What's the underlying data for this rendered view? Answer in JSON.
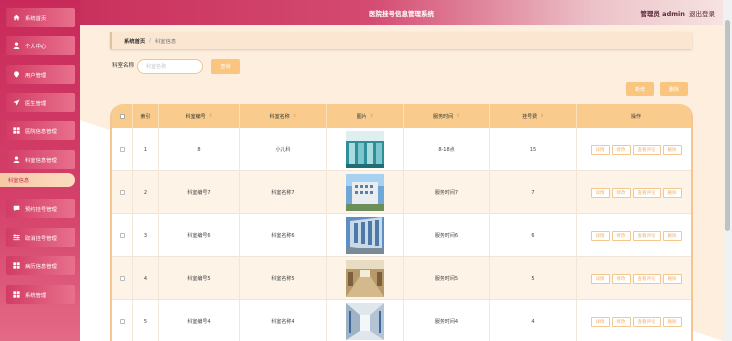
{
  "app": {
    "title": "医院挂号信息管理系统",
    "user_label": "管理员 admin",
    "logout": "退出登录"
  },
  "sidebar": {
    "items": [
      {
        "label": "系统首页",
        "icon": "home-icon"
      },
      {
        "label": "个人中心",
        "icon": "user-icon"
      },
      {
        "label": "用户管理",
        "icon": "pin-icon"
      },
      {
        "label": "医生管理",
        "icon": "send-icon"
      },
      {
        "label": "医院信息管理",
        "icon": "grid-icon"
      },
      {
        "label": "科室信息管理",
        "icon": "user-icon"
      },
      {
        "label": "预约挂号管理",
        "icon": "chat-icon"
      },
      {
        "label": "取消挂号管理",
        "icon": "sliders-icon"
      },
      {
        "label": "病历信息管理",
        "icon": "grid-icon"
      },
      {
        "label": "系统管理",
        "icon": "grid-icon"
      }
    ],
    "active_sub": "科室信息"
  },
  "breadcrumb": {
    "home": "系统首页",
    "separator": "/",
    "current": "科室信息"
  },
  "search": {
    "label": "科室名称",
    "placeholder": "科室名称",
    "button": "查询"
  },
  "actions": {
    "add": "新增",
    "delete": "删除"
  },
  "table": {
    "headers": {
      "index": "索引",
      "code": "科室编号",
      "name": "科室名称",
      "image": "图片",
      "time": "服务时间",
      "fee": "挂号费",
      "ops": "操作"
    },
    "op_labels": {
      "detail": "详情",
      "edit": "修改",
      "review": "查看评论",
      "delete": "删除"
    },
    "rows": [
      {
        "index": "1",
        "code": "8",
        "name": "小儿科",
        "time": "8-18点",
        "fee": "15"
      },
      {
        "index": "2",
        "code": "科室编号7",
        "name": "科室名称7",
        "time": "服务时间7",
        "fee": "7"
      },
      {
        "index": "3",
        "code": "科室编号6",
        "name": "科室名称6",
        "time": "服务时间6",
        "fee": "6"
      },
      {
        "index": "4",
        "code": "科室编号5",
        "name": "科室名称5",
        "time": "服务时间5",
        "fee": "5"
      },
      {
        "index": "5",
        "code": "科室编号4",
        "name": "科室名称4",
        "time": "服务时间4",
        "fee": "4"
      }
    ]
  },
  "colors": {
    "brand": "#c8295a",
    "accent": "#f9c57f",
    "header_bg": "#f9cc8e"
  }
}
